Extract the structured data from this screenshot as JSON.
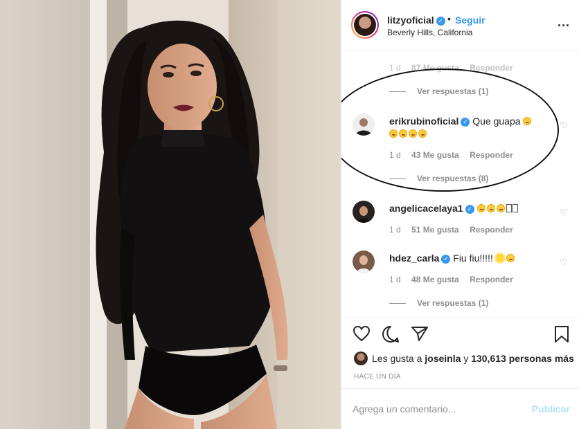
{
  "post": {
    "username": "litzyoficial",
    "dot": "•",
    "follow_label": "Seguir",
    "location": "Beverly Hills, California",
    "more_label": "..."
  },
  "comments": {
    "top_partial": {
      "time": "1 d",
      "likes": "87 Me gusta",
      "reply": "Responder"
    },
    "top_replies": "Ver respuestas (1)",
    "items": [
      {
        "username": "erikrubinoficial",
        "text": "Que guapa",
        "time": "1 d",
        "likes": "43 Me gusta",
        "reply": "Responder",
        "replies": "Ver respuestas (8)"
      },
      {
        "username": "angelicacelaya1",
        "text": "",
        "time": "1 d",
        "likes": "51 Me gusta",
        "reply": "Responder"
      },
      {
        "username": "hdez_carla",
        "text": "Fiu fiu!!!!!",
        "time": "1 d",
        "likes": "48 Me gusta",
        "reply": "Responder",
        "replies": "Ver respuestas (1)"
      }
    ]
  },
  "likes": {
    "prefix": "Les gusta a",
    "user": "joseinla",
    "connector": "y",
    "count": "130,613 personas más"
  },
  "time_ago": "HACE UN DÍA",
  "composer": {
    "placeholder": "Agrega un comentario...",
    "post_label": "Publicar"
  },
  "icons": {
    "like": "heart-outline-icon",
    "comment": "speech-bubble-icon",
    "share": "paper-plane-icon",
    "save": "bookmark-icon"
  }
}
